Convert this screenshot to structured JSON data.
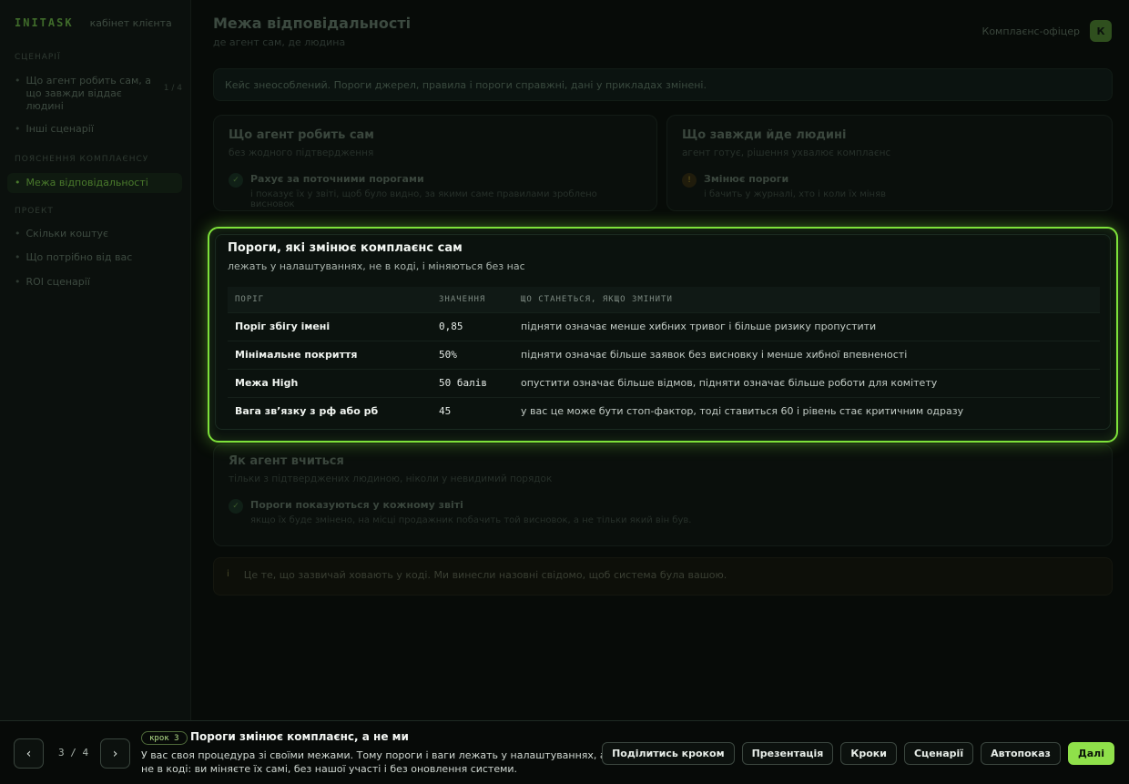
{
  "sidebar": {
    "brand": "INITASK",
    "brand_sub": "кабінет клієнта",
    "sections": [
      {
        "label": "СЦЕНАРІЇ"
      },
      {
        "label": "ПОЯСНЕННЯ КОМПЛАЄНСУ"
      },
      {
        "label": "ПРОЕКТ"
      }
    ],
    "items": [
      {
        "label": "Що агент робить сам, а що завжди віддає людині",
        "tag": "1 / 4"
      },
      {
        "label": "Інші сценарії"
      },
      {
        "label": "Межа відповідальності"
      },
      {
        "label": "Скільки коштує"
      },
      {
        "label": "Що потрібно від вас"
      },
      {
        "label": "ROI сценарії"
      }
    ]
  },
  "header": {
    "title": "Межа відповідальності",
    "subtitle": "де агент сам, де людина",
    "office": "Комплаєнс-офіцер",
    "avatar": "К"
  },
  "note": "Кейс знеособлений. Пороги джерел, правила і пороги справжні, дані у прикладах змінені.",
  "cards": {
    "agent": {
      "title": "Що агент робить сам",
      "subtitle": "без жодного підтвердження",
      "icon": "✓",
      "item_title": "Рахує за поточними порогами",
      "item_desc": "і показує їх у звіті, щоб було видно, за якими саме правилами зроблено висновок"
    },
    "human": {
      "title": "Що завжди йде людині",
      "subtitle": "агент готує, рішення ухвалює комплаєнс",
      "icon": "!",
      "item_title": "Змінює пороги",
      "item_desc": "і бачить у журналі, хто і коли їх міняв"
    },
    "learn": {
      "title": "Як агент вчиться",
      "subtitle": "тільки з підтверджених людиною, ніколи у невидимий порядок",
      "icon": "✓",
      "item_title": "Пороги показуються у кожному звіті",
      "item_desc": "якщо їх буде змінено, на місці продажник побачить той висновок, а не тільки який він був."
    }
  },
  "footnote": {
    "icon": "i",
    "text": "Це те, що зазвичай ховають у коді. Ми винесли назовні свідомо, щоб система була вашою."
  },
  "panel": {
    "title": "Пороги, які змінює комплаєнс сам",
    "subtitle": "лежать у налаштуваннях, не в коді, і міняються без нас",
    "columns": [
      "ПОРІГ",
      "ЗНАЧЕННЯ",
      "ЩО СТАНЕТЬСЯ, ЯКЩО ЗМІНИТИ"
    ],
    "rows": [
      {
        "name": "Поріг збігу імені",
        "value": "0,85",
        "effect": "підняти означає менше хибних тривог і більше ризику пропустити"
      },
      {
        "name": "Мінімальне покриття",
        "value": "50%",
        "effect": "підняти означає більше заявок без висновку і менше хибної впевненості"
      },
      {
        "name": "Межа High",
        "value": "50 балів",
        "effect": "опустити означає більше відмов, підняти означає більше роботи для комітету"
      },
      {
        "name": "Вага зв’язку з рф або рб",
        "value": "45",
        "effect": "у вас це може бути стоп-фактор, тоді ставиться 60 і рівень стає критичним одразу"
      }
    ]
  },
  "bottom": {
    "prev_icon": "‹",
    "next_icon": "›",
    "counter": "3 / 4",
    "step_badge": "крок 3",
    "step_title": "Пороги змінює комплаєнс, а не ми",
    "step_desc": "У вас своя процедура зі своїми межами. Тому пороги і ваги лежать у налаштуваннях, а не в коді: ви міняєте їх самі, без нашої участі і без оновлення системи.",
    "buttons": {
      "share": "Поділитись кроком",
      "present": "Презентація",
      "steps": "Кроки",
      "scenarios": "Сценарії",
      "autoplay": "Автопоказ",
      "next": "Далі"
    }
  },
  "colors": {
    "accent": "#8fe04a",
    "highlight_border": "#7ee23a",
    "background": "#050806"
  }
}
